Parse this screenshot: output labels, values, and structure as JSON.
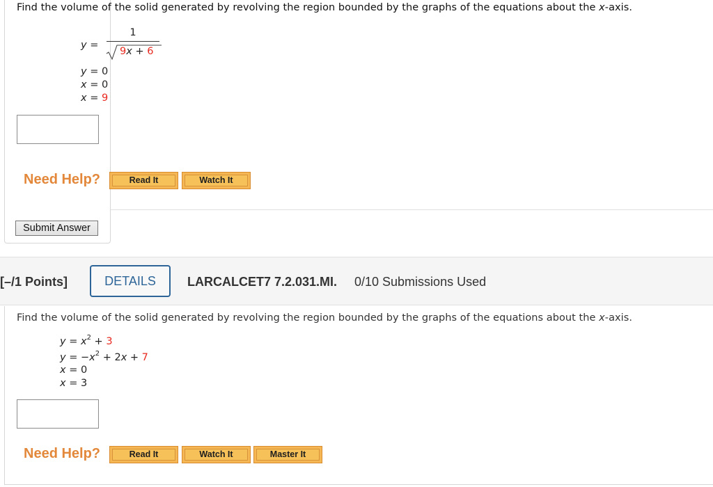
{
  "question1": {
    "prompt_before": "Find the volume of the solid generated by revolving the region bounded by the graphs of the equations about the ",
    "prompt_var": "x",
    "prompt_after": "-axis.",
    "equations": {
      "eq1": {
        "lhs": "y",
        "equals": "=",
        "numerator": "1",
        "radicand_coef": "9",
        "radicand_var": "x",
        "radicand_op": "+",
        "radicand_const": "6"
      },
      "eq2": {
        "lhs": "y",
        "rhs": "= 0"
      },
      "eq3": {
        "lhs": "x",
        "rhs": "= 0"
      },
      "eq4": {
        "lhs": "x",
        "rhs_prefix": "= ",
        "rhs_value": "9"
      }
    },
    "answer_value": "",
    "need_help_label": "Need Help?",
    "help_buttons": [
      "Read It",
      "Watch It"
    ],
    "submit_label": "Submit Answer"
  },
  "question2": {
    "points": "[–/1 Points]",
    "details_label": "DETAILS",
    "code": "LARCALCET7 7.2.031.MI.",
    "submissions": "0/10 Submissions Used",
    "prompt_before": "Find the volume of the solid generated by revolving the region bounded by the graphs of the equations about the ",
    "prompt_var": "x",
    "prompt_after": "-axis.",
    "equations": {
      "eq1": {
        "lhs": "y",
        "mid": " = ",
        "var": "x",
        "exp": "2",
        "op": " + ",
        "const": "3"
      },
      "eq2": {
        "lhs": "y",
        "mid": " = −",
        "var": "x",
        "exp": "2",
        "op": " + 2",
        "var2": "x",
        "op2": " + ",
        "const": "7"
      },
      "eq3": {
        "lhs": "x",
        "rhs": " = 0"
      },
      "eq4": {
        "lhs": "x",
        "rhs": " = 3"
      }
    },
    "answer_value": "",
    "need_help_label": "Need Help?",
    "help_buttons": [
      "Read It",
      "Watch It",
      "Master It"
    ]
  },
  "colors": {
    "highlight_red": "#e8281f",
    "need_help_orange": "#e3883a",
    "help_button_fill": "#f7c15a",
    "details_blue": "#2e6598"
  }
}
